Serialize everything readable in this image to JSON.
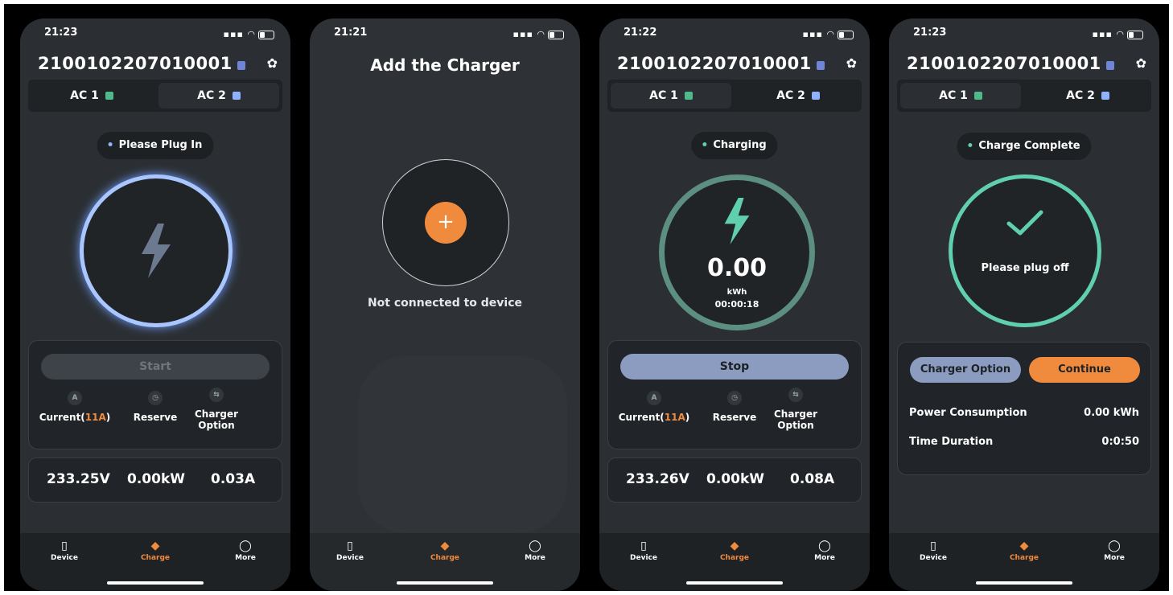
{
  "colors": {
    "accent_orange": "#f08b3e",
    "teal": "#5fcfae",
    "blue_ring": "#9fc0ff",
    "stop_button": "#8b9cc0",
    "bg": "#2b2f33"
  },
  "screens": [
    {
      "time": "21:23",
      "device_id": "2100102207010001",
      "tabs": [
        {
          "label": "AC 1"
        },
        {
          "label": "AC 2"
        }
      ],
      "status": "Please Plug In",
      "start_label": "Start",
      "options": {
        "current_prefix": "Current(",
        "current_value": "11A",
        "current_suffix": ")",
        "reserve": "Reserve",
        "charger_option": "Charger Option"
      },
      "metrics": {
        "voltage": "233.25V",
        "power": "0.00kW",
        "amps": "0.03A"
      },
      "nav": {
        "device": "Device",
        "charge": "Charge",
        "more": "More"
      }
    },
    {
      "time": "21:21",
      "title": "Add the Charger",
      "add_icon": "+",
      "message": "Not connected to device",
      "nav": {
        "device": "Device",
        "charge": "Charge",
        "more": "More"
      }
    },
    {
      "time": "21:22",
      "device_id": "2100102207010001",
      "tabs": [
        {
          "label": "AC 1"
        },
        {
          "label": "AC 2"
        }
      ],
      "status": "Charging",
      "energy": "0.00",
      "energy_unit": "kWh",
      "elapsed": "00:00:18",
      "stop_label": "Stop",
      "options": {
        "current_prefix": "Current(",
        "current_value": "11A",
        "current_suffix": ")",
        "reserve": "Reserve",
        "charger_option": "Charger Option"
      },
      "metrics": {
        "voltage": "233.26V",
        "power": "0.00kW",
        "amps": "0.08A"
      },
      "nav": {
        "device": "Device",
        "charge": "Charge",
        "more": "More"
      }
    },
    {
      "time": "21:23",
      "device_id": "2100102207010001",
      "tabs": [
        {
          "label": "AC 1"
        },
        {
          "label": "AC 2"
        }
      ],
      "status": "Charge Complete",
      "ring_message": "Please plug off",
      "charger_option_label": "Charger Option",
      "continue_label": "Continue",
      "summary": [
        {
          "label": "Power Consumption",
          "value": "0.00 kWh"
        },
        {
          "label": "Time Duration",
          "value": "0:0:50"
        }
      ],
      "nav": {
        "device": "Device",
        "charge": "Charge",
        "more": "More"
      }
    }
  ]
}
